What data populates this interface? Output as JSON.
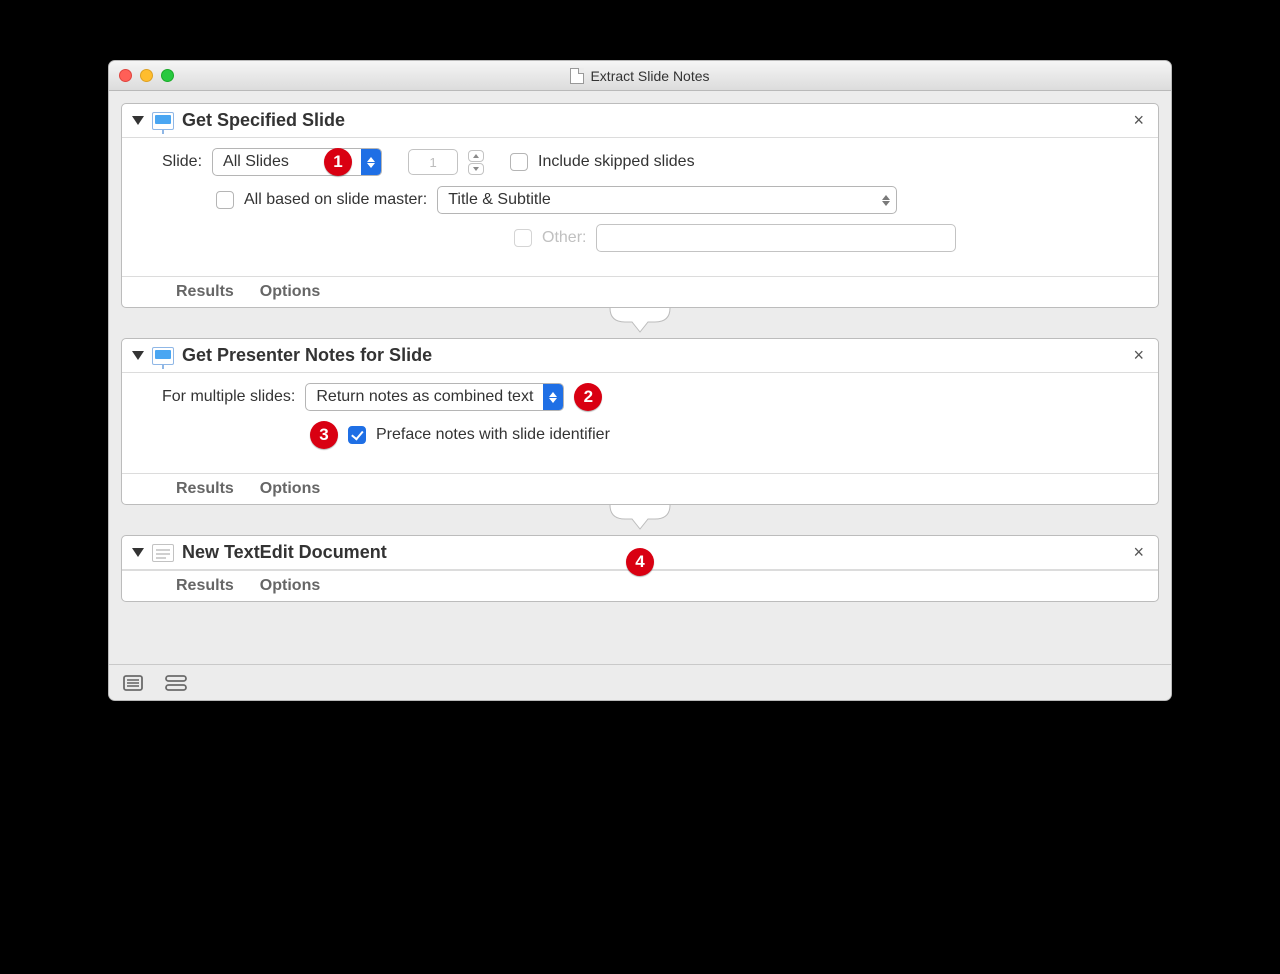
{
  "window": {
    "title": "Extract Slide Notes"
  },
  "action1": {
    "title": "Get Specified Slide",
    "slideLabel": "Slide:",
    "slideDropdown": "All Slides",
    "numberValue": "1",
    "includeSkipped": "Include skipped slides",
    "masterLabel": "All based on slide master:",
    "masterDropdown": "Title & Subtitle",
    "otherLabel": "Other:",
    "results": "Results",
    "options": "Options"
  },
  "action2": {
    "title": "Get Presenter Notes for Slide",
    "multiLabel": "For multiple slides:",
    "multiDropdown": "Return notes as combined text",
    "prefaceLabel": "Preface notes with slide identifier",
    "results": "Results",
    "options": "Options"
  },
  "action3": {
    "title": "New TextEdit Document",
    "results": "Results",
    "options": "Options"
  },
  "callouts": {
    "c1": "1",
    "c2": "2",
    "c3": "3",
    "c4": "4"
  }
}
